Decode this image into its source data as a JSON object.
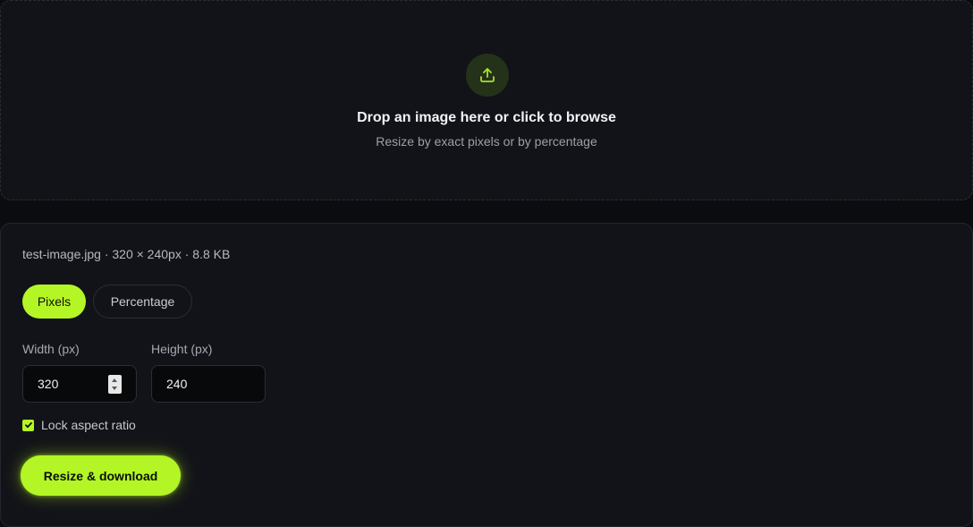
{
  "dropzone": {
    "icon": "upload-icon",
    "title": "Drop an image here or click to browse",
    "subtitle": "Resize by exact pixels or by percentage"
  },
  "file": {
    "info": "test-image.jpg · 320 × 240px · 8.8 KB"
  },
  "mode": {
    "options": [
      "Pixels",
      "Percentage"
    ],
    "selected": "Pixels"
  },
  "width": {
    "label": "Width (px)",
    "value": "320"
  },
  "height": {
    "label": "Height (px)",
    "value": "240"
  },
  "lock": {
    "label": "Lock aspect ratio",
    "checked": true
  },
  "actions": {
    "resize_label": "Resize & download"
  },
  "colors": {
    "accent": "#b4f625",
    "background": "#0b0c0f",
    "panel": "#121318"
  }
}
